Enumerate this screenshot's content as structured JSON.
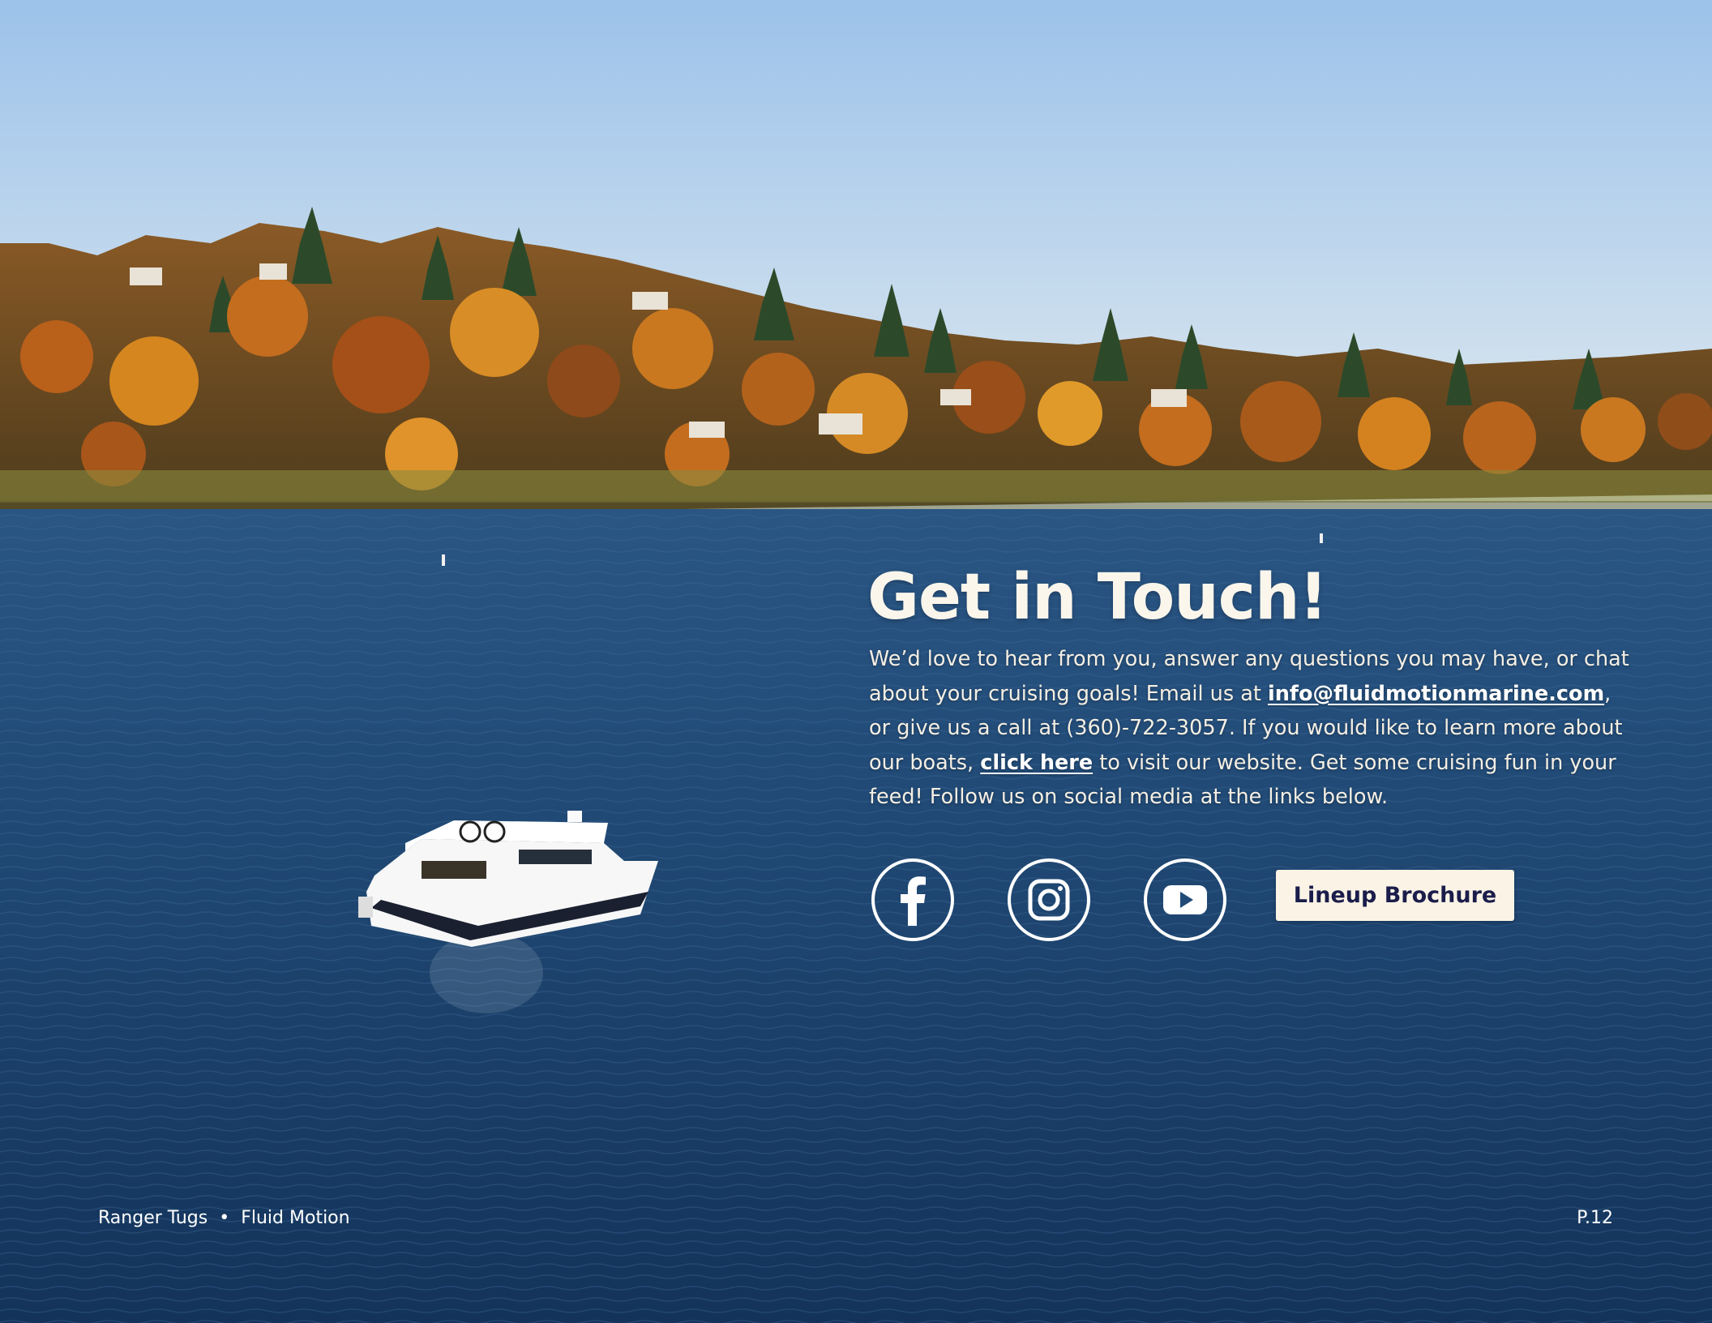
{
  "headline": "Get in Touch!",
  "body": {
    "part1": "We’d love to hear from you, answer any questions you may have, or chat about your cruising goals! Email us at ",
    "email_link": "info@fluidmotionmarine.com",
    "part2": ", or give us a call at (360)-722-3057. If you would like to learn more about our boats, ",
    "website_link": "click here",
    "part3": " to visit our website. Get some cruising fun in your feed! Follow us on social media at the links below."
  },
  "social": {
    "items": [
      {
        "name": "Facebook",
        "icon": "facebook-icon"
      },
      {
        "name": "Instagram",
        "icon": "instagram-icon"
      },
      {
        "name": "YouTube",
        "icon": "youtube-icon"
      }
    ]
  },
  "brochure_button": "Lineup Brochure",
  "footer": {
    "brand": "Ranger Tugs",
    "separator": "•",
    "product": "Fluid Motion",
    "page": "P.12"
  },
  "colors": {
    "sky_top": "#9ec3e9",
    "sky_bottom": "#e4eef1",
    "water": "#1a3e66",
    "foliage": "#c8701f",
    "evergreen": "#2e4a2c",
    "text": "#f4efe4",
    "button_bg": "#fbf4e6",
    "button_text": "#1b1d4b"
  }
}
